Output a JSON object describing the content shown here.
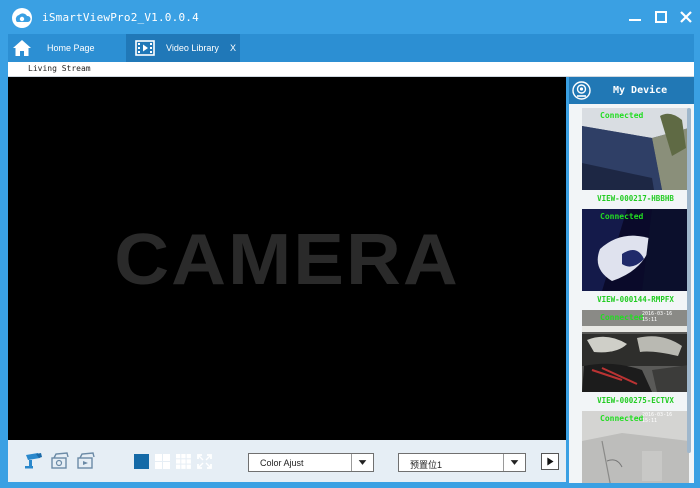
{
  "window": {
    "title": "iSmartViewPro2_V1.0.0.4"
  },
  "tabs": {
    "home_label": "Home Page",
    "video_label": "Video Library",
    "video_close": "X"
  },
  "subheader": {
    "label": "Living Stream"
  },
  "video": {
    "placeholder_text": "CAMERA"
  },
  "toolbar": {
    "color_select_value": "Color Ajust",
    "preset_select_value": "预置位1"
  },
  "device_panel": {
    "title": "My Device",
    "devices": [
      {
        "status": "Connected",
        "timestamp": "",
        "name": "VIEW-000217-HBBHB"
      },
      {
        "status": "Connected",
        "timestamp": "",
        "name": "VIEW-000144-RMPFX"
      },
      {
        "status": "Connected",
        "timestamp": "2016-03-16 15:11",
        "name": "VIEW-000275-ECTVX"
      },
      {
        "status": "Connected",
        "timestamp": "2016-03-16 15:11",
        "name": ""
      }
    ]
  },
  "colors": {
    "titlebar": "#3aa0e3",
    "tabbar": "#2c8fd3",
    "active_tab": "#2078b8",
    "device_header": "#2178b5",
    "status_green": "#22dd22",
    "layout_active": "#156aa7"
  }
}
